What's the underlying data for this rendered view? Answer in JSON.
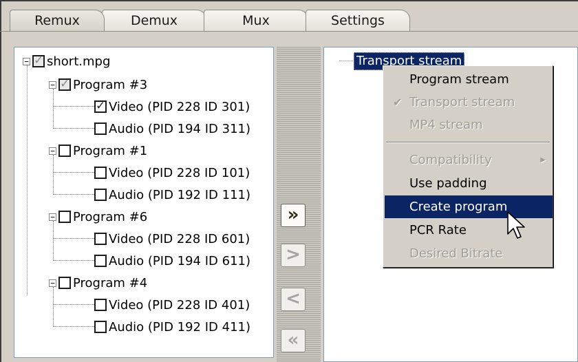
{
  "tabs": [
    {
      "label": "Remux",
      "active": true
    },
    {
      "label": "Demux",
      "active": false
    },
    {
      "label": "Mux",
      "active": false
    },
    {
      "label": "Settings",
      "active": false
    }
  ],
  "tree": {
    "root": {
      "label": "short.mpg",
      "state": "partial"
    },
    "programs": [
      {
        "label": "Program #3",
        "state": "partial",
        "streams": [
          {
            "label": "Video (PID 228 ID 301)",
            "checked": true
          },
          {
            "label": "Audio (PID 194 ID 311)",
            "checked": false
          }
        ]
      },
      {
        "label": "Program #1",
        "state": "unchecked",
        "streams": [
          {
            "label": "Video (PID 228 ID 101)",
            "checked": false
          },
          {
            "label": "Audio (PID 192 ID 111)",
            "checked": false
          }
        ]
      },
      {
        "label": "Program #6",
        "state": "unchecked",
        "streams": [
          {
            "label": "Video (PID 228 ID 601)",
            "checked": false
          },
          {
            "label": "Audio (PID 194 ID 611)",
            "checked": false
          }
        ]
      },
      {
        "label": "Program #4",
        "state": "unchecked",
        "streams": [
          {
            "label": "Video (PID 228 ID 401)",
            "checked": false
          },
          {
            "label": "Audio (PID 192 ID 411)",
            "checked": false
          }
        ]
      }
    ]
  },
  "move_buttons": {
    "add_all": "»",
    "add": ">",
    "remove": "<",
    "remove_all": "«"
  },
  "output": {
    "selected_node": "Transport stream"
  },
  "context_menu": {
    "items": [
      {
        "label": "Program stream",
        "enabled": true
      },
      {
        "label": "Transport stream",
        "enabled": false,
        "checked": true
      },
      {
        "label": "MP4 stream",
        "enabled": false
      },
      {
        "label": "Compatibility",
        "enabled": false,
        "submenu": true
      },
      {
        "label": "Use padding",
        "enabled": true
      },
      {
        "label": "Create program",
        "enabled": true,
        "highlighted": true
      },
      {
        "label": "PCR Rate",
        "enabled": true
      },
      {
        "label": "Desired Bitrate",
        "enabled": false
      }
    ]
  },
  "colors": {
    "selection": "#0b2463",
    "window_bg": "#d4d0c8",
    "disabled_text": "#a09e96"
  },
  "icons": {
    "check": "check-icon",
    "submenu": "submenu-arrow-icon",
    "cursor": "mouse-pointer-icon"
  }
}
